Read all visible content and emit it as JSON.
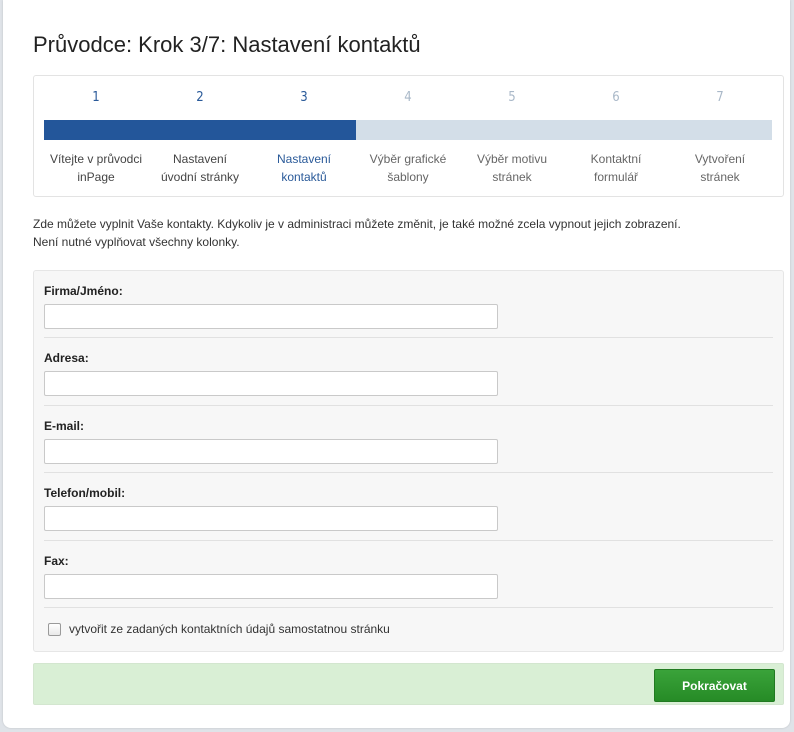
{
  "title": "Průvodce: Krok 3/7: Nastavení kontaktů",
  "wizard": {
    "progress_fraction": 0.428,
    "steps": [
      {
        "number": "1",
        "label": "Vítejte v průvodci\ninPage"
      },
      {
        "number": "2",
        "label": "Nastavení\núvodní stránky"
      },
      {
        "number": "3",
        "label": "Nastavení\nkontaktů"
      },
      {
        "number": "4",
        "label": "Výběr grafické\nšablony"
      },
      {
        "number": "5",
        "label": "Výběr motivu\nstránek"
      },
      {
        "number": "6",
        "label": "Kontaktní\nformulář"
      },
      {
        "number": "7",
        "label": "Vytvoření\nstránek"
      }
    ]
  },
  "intro": {
    "line1": "Zde můžete vyplnit Vaše kontakty. Kdykoliv je v administraci můžete změnit, je také možné zcela vypnout jejich zobrazení.",
    "line2": "Není nutné vyplňovat všechny kolonky."
  },
  "form": {
    "company_label": "Firma/Jméno:",
    "company_value": "",
    "address_label": "Adresa:",
    "address_value": "",
    "email_label": "E-mail:",
    "email_value": "",
    "phone_label": "Telefon/mobil:",
    "phone_value": "",
    "fax_label": "Fax:",
    "fax_value": "",
    "create_page_checkbox_label": "vytvořit ze zadaných kontaktních údajů samostatnou stránku",
    "create_page_checked": false
  },
  "footer": {
    "continue_label": "Pokračovat"
  },
  "colors": {
    "progress_fill": "#23569a",
    "progress_track": "#d3dee8",
    "footer_bg": "#d9efd5",
    "button_green": "#2f962f"
  }
}
